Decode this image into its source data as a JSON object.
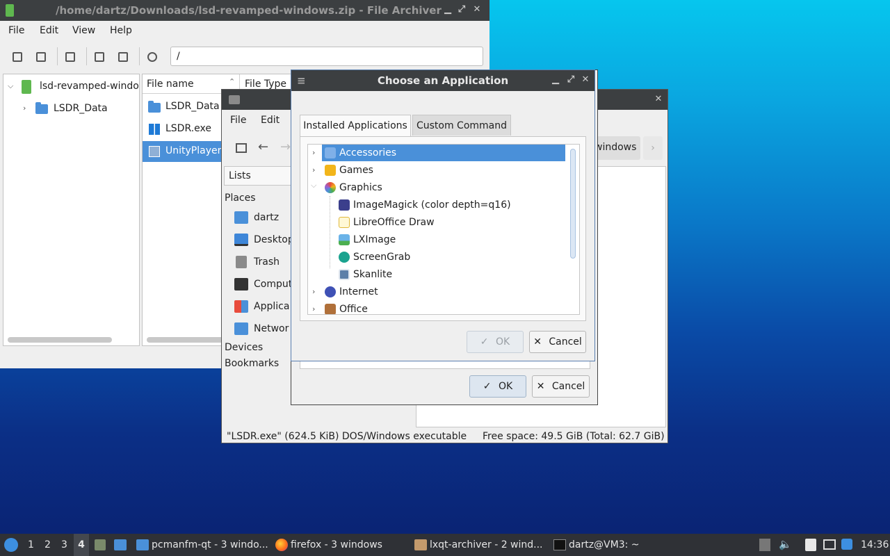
{
  "archiver": {
    "title": "/home/dartz/Downloads/lsd-revamped-windows.zip - File Archiver",
    "menu": [
      "File",
      "Edit",
      "View",
      "Help"
    ],
    "path_value": "/",
    "tree": {
      "root": "lsd-revamped-windo",
      "child": "LSDR_Data"
    },
    "columns": {
      "name": "File name",
      "type": "File Type"
    },
    "files": [
      "LSDR_Data",
      "LSDR.exe",
      "UnityPlayer."
    ]
  },
  "filemanager": {
    "menu": [
      "File",
      "Edit"
    ],
    "side_mode": "Lists",
    "places_label": "Places",
    "places": [
      "dartz",
      "Desktop",
      "Trash",
      "Comput",
      "Applica",
      "Networ"
    ],
    "devices_label": "Devices",
    "bookmarks_label": "Bookmarks",
    "path_fragment": "windows",
    "status_left": "\"LSDR.exe\" (624.5 KiB) DOS/Windows executable",
    "status_right": "Free space: 49.5 GiB (Total: 62.7 GiB)"
  },
  "openwith": {
    "ok_label": "OK",
    "cancel_label": "Cancel"
  },
  "dialog": {
    "title": "Choose an Application",
    "tabs": [
      "Installed Applications",
      "Custom Command"
    ],
    "categories": [
      {
        "label": "Accessories",
        "selected": true,
        "expanded": false
      },
      {
        "label": "Games",
        "expanded": false
      },
      {
        "label": "Graphics",
        "expanded": true
      }
    ],
    "graphics_apps": [
      "ImageMagick (color depth=q16)",
      "LibreOffice Draw",
      "LXImage",
      "ScreenGrab",
      "Skanlite"
    ],
    "more_categories": [
      "Internet",
      "Office"
    ],
    "ok_label": "OK",
    "cancel_label": "Cancel"
  },
  "taskbar": {
    "desktops": [
      "1",
      "2",
      "3",
      "4"
    ],
    "active_desktop": "4",
    "tasks": [
      "pcmanfm-qt - 3 windo...",
      "firefox - 3 windows",
      "lxqt-archiver - 2 wind...",
      "dartz@VM3: ~"
    ],
    "clock": "14:36"
  },
  "colors": {
    "selection": "#4a90d9",
    "titlebar": "#3c3f41",
    "panel": "#2f3136"
  }
}
